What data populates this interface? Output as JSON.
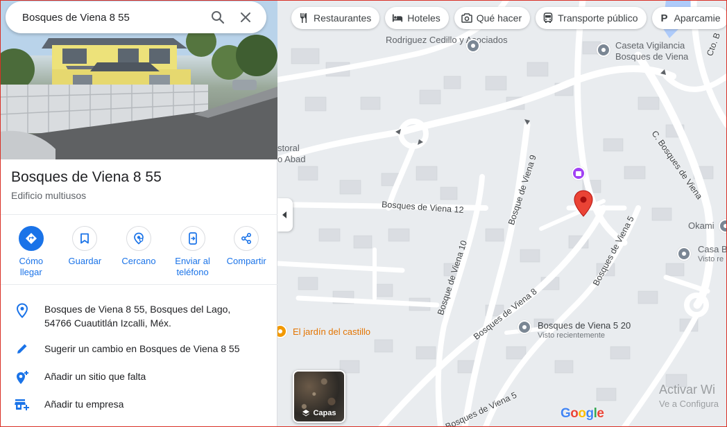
{
  "search": {
    "value": "Bosques de Viena 8 55"
  },
  "place": {
    "title": "Bosques de Viena 8 55",
    "type": "Edificio multiusos"
  },
  "actions": [
    {
      "label": "Cómo llegar"
    },
    {
      "label": "Guardar"
    },
    {
      "label": "Cercano"
    },
    {
      "label": "Enviar al teléfono"
    },
    {
      "label": "Compartir"
    }
  ],
  "info": {
    "address": "Bosques de Viena 8 55, Bosques del Lago, 54766 Cuautitlán Izcalli, Méx.",
    "suggest": "Sugerir un cambio en Bosques de Viena 8 55",
    "add_place": "Añadir un sitio que falta",
    "add_business": "Añadir tu empresa"
  },
  "chips": [
    {
      "label": "Restaurantes",
      "icon": "fork-knife-icon"
    },
    {
      "label": "Hoteles",
      "icon": "bed-icon"
    },
    {
      "label": "Qué hacer",
      "icon": "camera-icon"
    },
    {
      "label": "Transporte público",
      "icon": "bus-icon"
    },
    {
      "label": "Aparcamie",
      "icon": "parking-icon"
    }
  ],
  "map": {
    "labels": {
      "rodriguez": "Rodriguez Cedillo y Asociados",
      "caseta": "Caseta Vigilancia Bosques de Viena",
      "cto": "Cto. B",
      "c_bosques": "C. Bosques de Viena",
      "pastoral": "storal",
      "abad": "o Abad",
      "okami": "Okami",
      "casa": "Casa B",
      "casa_sub": "Visto re",
      "bv12": "Bosques de Viena 12",
      "bv9": "Bosque de Viena 9",
      "bv10": "Bosque de Viena 10",
      "bv8": "Bosques de Viena 8",
      "bv5": "Bosques de Viena 5",
      "bv5b": "Bosques de Viena 5",
      "bv5_20": "Bosques de Viena 5 20",
      "bv5_20_sub": "Visto recientemente",
      "jardin": "El jardín del castillo"
    },
    "layers_label": "Capas",
    "google": "Google",
    "watermark": "Activar Wi",
    "watermark_sub": "Ve a Configura"
  },
  "colors": {
    "accent": "#1a73e8",
    "pin": "#ea4335",
    "road": "#ffffff",
    "block": "#d7dce1"
  }
}
